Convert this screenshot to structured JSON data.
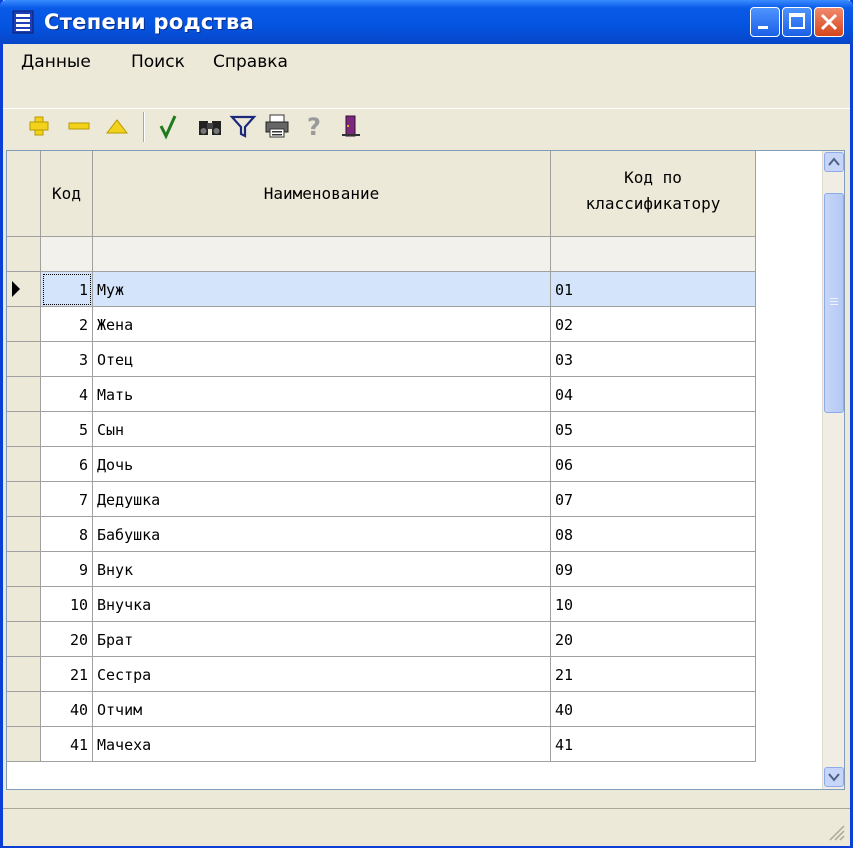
{
  "window": {
    "title": "Степени родства",
    "accent_color": "#0454e0",
    "close_color": "#d5451c"
  },
  "menu": {
    "items": [
      {
        "label": "Данные"
      },
      {
        "label": "Поиск"
      },
      {
        "label": "Справка"
      }
    ]
  },
  "toolbar": {
    "tools": [
      {
        "icon": "add-plus-icon"
      },
      {
        "icon": "remove-minus-icon"
      },
      {
        "icon": "edit-triangle-icon"
      },
      {
        "icon": "confirm-check-icon"
      },
      {
        "icon": "find-binoculars-icon"
      },
      {
        "icon": "filter-funnel-icon"
      },
      {
        "icon": "print-printer-icon"
      },
      {
        "icon": "help-question-icon"
      },
      {
        "icon": "exit-door-icon"
      }
    ]
  },
  "table": {
    "columns": {
      "code": "Код",
      "name": "Наименование",
      "classifier_line1": "Код по",
      "classifier_line2": "классификатору"
    },
    "filter_row": {
      "code": "",
      "name": "",
      "classifier": ""
    },
    "selected_index": 0,
    "rows": [
      {
        "code": "1",
        "name": "Муж",
        "classifier": "01"
      },
      {
        "code": "2",
        "name": "Жена",
        "classifier": "02"
      },
      {
        "code": "3",
        "name": "Отец",
        "classifier": "03"
      },
      {
        "code": "4",
        "name": "Мать",
        "classifier": "04"
      },
      {
        "code": "5",
        "name": "Сын",
        "classifier": "05"
      },
      {
        "code": "6",
        "name": "Дочь",
        "classifier": "06"
      },
      {
        "code": "7",
        "name": "Дедушка",
        "classifier": "07"
      },
      {
        "code": "8",
        "name": "Бабушка",
        "classifier": "08"
      },
      {
        "code": "9",
        "name": "Внук",
        "classifier": "09"
      },
      {
        "code": "10",
        "name": "Внучка",
        "classifier": "10"
      },
      {
        "code": "20",
        "name": "Брат",
        "classifier": "20"
      },
      {
        "code": "21",
        "name": "Сестра",
        "classifier": "21"
      },
      {
        "code": "40",
        "name": "Отчим",
        "classifier": "40"
      },
      {
        "code": "41",
        "name": "Мачеха",
        "classifier": "41"
      }
    ]
  },
  "colors": {
    "selected_row": "#d4e4fa",
    "grid_line": "#a0a0a0"
  }
}
